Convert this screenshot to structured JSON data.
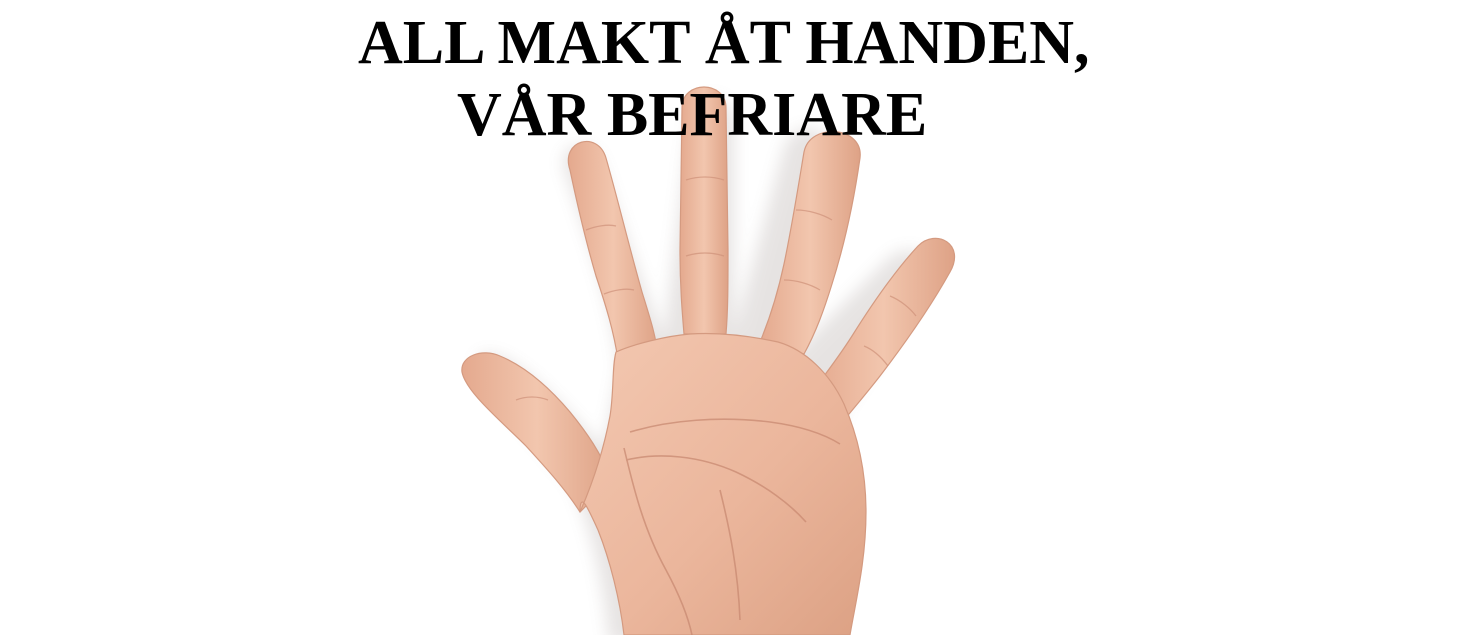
{
  "headline": {
    "line1": "ALL MAKT ÅT HANDEN,",
    "line2": "VÅR BEFRIARE"
  },
  "image": {
    "subject": "open-palm-hand-icon"
  },
  "colors": {
    "background": "#ffffff",
    "text": "#000000",
    "skin": "#eebca3",
    "skin_shadow": "#d99d85",
    "palm_lines": "#c98a72"
  }
}
